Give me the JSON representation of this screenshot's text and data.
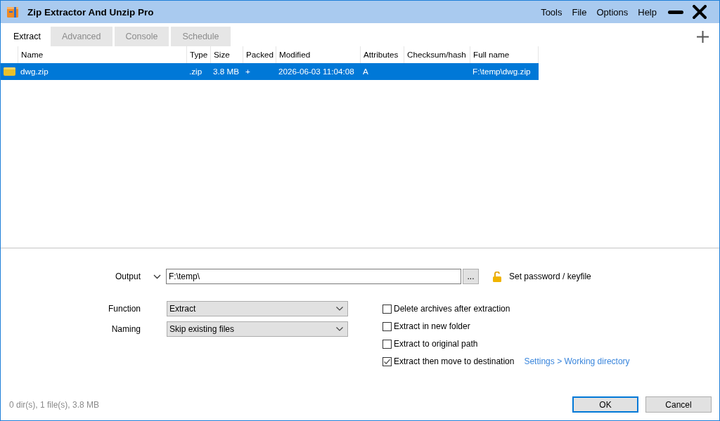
{
  "window": {
    "title": "Zip Extractor And Unzip Pro"
  },
  "menu": [
    "Tools",
    "File",
    "Options",
    "Help"
  ],
  "tabs": [
    {
      "label": "Extract",
      "selected": true
    },
    {
      "label": "Advanced",
      "selected": false
    },
    {
      "label": "Console",
      "selected": false
    },
    {
      "label": "Schedule",
      "selected": false
    }
  ],
  "table": {
    "columns": [
      "Name",
      "Type",
      "Size",
      "Packed",
      "Modified",
      "Attributes",
      "Checksum/hash",
      "Full name"
    ],
    "rows": [
      {
        "name": "dwg.zip",
        "type": ".zip",
        "size": "3.8 MB",
        "packed": "+",
        "modified": "2026-06-03 11:04:08",
        "attributes": "A",
        "full_name": "F:\\temp\\dwg.zip",
        "selected": true
      }
    ]
  },
  "output": {
    "label": "Output",
    "value": "F:\\temp\\",
    "browse": "...",
    "password": "Set password / keyfile"
  },
  "selects": [
    {
      "label": "Function",
      "value": "Extract"
    },
    {
      "label": "Naming",
      "value": "Skip existing files"
    }
  ],
  "options": [
    {
      "label": "Delete archives after extraction",
      "checked": false
    },
    {
      "label": "Extract in new folder",
      "checked": false
    },
    {
      "label": "Extract to original path",
      "checked": false
    },
    {
      "label": "Extract then move to destination",
      "checked": true,
      "link": "Settings > Working directory"
    }
  ],
  "status_bar": "0 dir(s), 1 file(s), 3.8 MB",
  "buttons": [
    {
      "label": "OK",
      "default": true
    },
    {
      "label": "Cancel",
      "default": false
    }
  ]
}
